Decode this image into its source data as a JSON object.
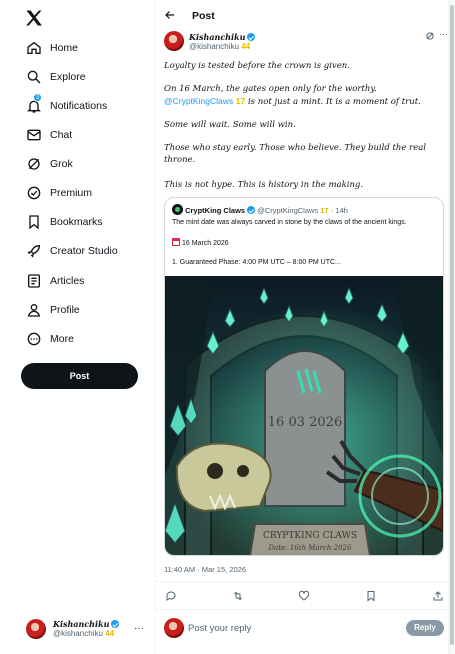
{
  "sidebar": {
    "items": [
      {
        "label": "Home",
        "icon": "home-icon"
      },
      {
        "label": "Explore",
        "icon": "search-icon"
      },
      {
        "label": "Notifications",
        "icon": "bell-icon",
        "badge": "3"
      },
      {
        "label": "Chat",
        "icon": "mail-icon"
      },
      {
        "label": "Grok",
        "icon": "grok-icon"
      },
      {
        "label": "Premium",
        "icon": "x-premium-icon"
      },
      {
        "label": "Bookmarks",
        "icon": "bookmark-icon"
      },
      {
        "label": "Creator Studio",
        "icon": "rocket-icon"
      },
      {
        "label": "Articles",
        "icon": "article-icon"
      },
      {
        "label": "Profile",
        "icon": "person-icon"
      },
      {
        "label": "More",
        "icon": "more-circle-icon"
      }
    ],
    "post_button": "Post",
    "account": {
      "name": "Kishanchiku",
      "handle": "@kishanchiku",
      "number": "44"
    }
  },
  "header": {
    "title": "Post"
  },
  "post": {
    "author": {
      "name": "Kishanchiku",
      "handle": "@kishanchiku",
      "number": "44"
    },
    "paragraphs": {
      "p1": "Loyalty is tested before the crown is given.",
      "p2a": "On 16 March, the gates open only for the worthy.",
      "p2_mention": "@CryptKingClaws",
      "p2_num": "17",
      "p2b": " is not just a mint. It is a moment of trut.",
      "p3": "Some will wait. Some will win.",
      "p4": "Those who stay early. Those who believe. They build the real throne.",
      "p5": "This is not hype. This is history in the making."
    },
    "quote": {
      "name": "CryptKing Claws",
      "handle": "@CryptKingClaws",
      "number": "17",
      "time": "· 14h",
      "line1": "The mint date was always carved in stone by the claws of the ancient kings.",
      "date": "16 March 2026",
      "phase": "1. Guaranteed Phase: 4:00 PM UTC – 8:00 PM UTC...",
      "image": {
        "stone_date": "16 03 2026",
        "plaque_title": "CRYPTKING CLAWS",
        "plaque_sub": "Date: 16th March 2026"
      }
    },
    "timestamp": "11:40 AM · Mar 15, 2026"
  },
  "reply": {
    "placeholder": "Post your reply",
    "button": "Reply"
  },
  "colors": {
    "accent": "#1d9bf0",
    "text": "#0f1419",
    "muted": "#536471",
    "gold": "#e6b800"
  }
}
